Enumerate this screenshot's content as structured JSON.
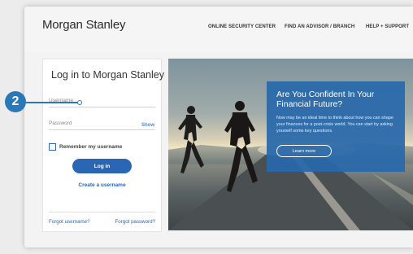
{
  "header": {
    "logo": "Morgan Stanley",
    "nav": [
      "ONLINE SECURITY CENTER",
      "FIND AN ADVISOR / BRANCH",
      "HELP + SUPPORT"
    ]
  },
  "login": {
    "title": "Log in to Morgan Stanley",
    "username_placeholder": "Username",
    "password_placeholder": "Password",
    "show_label": "Show",
    "remember_label": "Remember my username",
    "login_button": "Log in",
    "create_username": "Create a username",
    "forgot_username": "Forgot username?",
    "forgot_password": "Forgot password?"
  },
  "promo": {
    "heading": "Are You Confident In Your Financial Future?",
    "body": "Now may be an ideal time to think about how you can shape your finances for a post-crisis world. You can start by asking yourself some key questions.",
    "button": "Learn more"
  },
  "callout": {
    "step_number": "2"
  },
  "colors": {
    "accent": "#2b66b5",
    "promo_bg": "#2868aa",
    "callout": "#2b78b8"
  }
}
